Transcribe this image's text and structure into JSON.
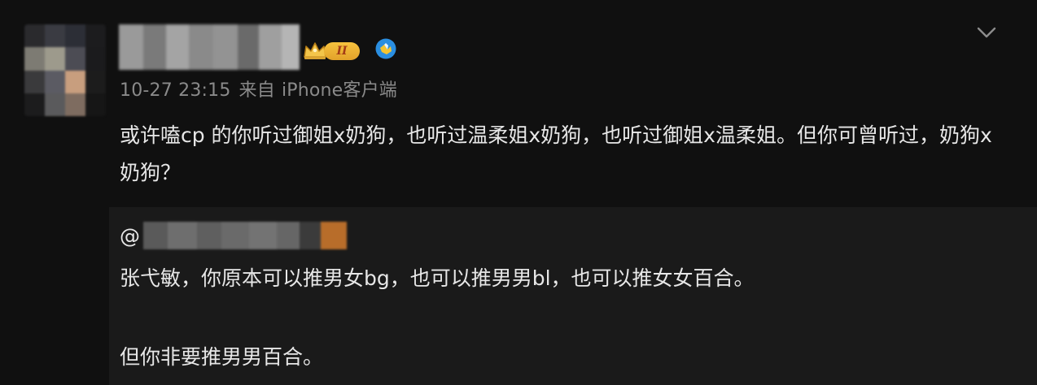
{
  "post": {
    "time": "10-27 23:15",
    "source_prefix": "来自",
    "source_device": "iPhone客户端",
    "level_badge": "II",
    "content": "或许嗑cp 的你听过御姐x奶狗，也听过温柔姐x奶狗，也听过御姐x温柔姐。但你可曾听过，奶狗x奶狗？"
  },
  "repost": {
    "mention_prefix": "@",
    "line1": "张弋敏，你原本可以推男女bg，也可以推男男bl，也可以推女女百合。",
    "line2": "但你非要推男男百合。"
  },
  "icons": {
    "dropdown": "chevron-down-icon",
    "crown": "crown-icon",
    "verified": "verified-icon"
  },
  "colors": {
    "background": "#101010",
    "repost_background": "#1a1a1a",
    "text": "#e7e7e7",
    "meta_text": "#8a8a8a",
    "badge_gold": "#f6c23e",
    "verified_blue": "#2a8ee0",
    "verified_yellow": "#f4c430"
  }
}
